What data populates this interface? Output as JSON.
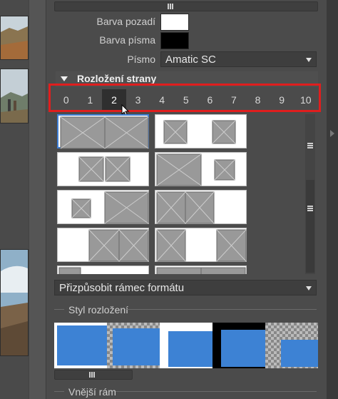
{
  "props": {
    "barva_pozadi_label": "Barva pozadí",
    "barva_pisma_label": "Barva písma",
    "pismo_label": "Písmo",
    "pismo_value": "Amatic SC",
    "bg_color": "#ffffff",
    "font_color": "#000000"
  },
  "layout_section": {
    "title": "Rozložení strany",
    "numbers": [
      "0",
      "1",
      "2",
      "3",
      "4",
      "5",
      "6",
      "7",
      "8",
      "9",
      "10"
    ],
    "selected_index": 2
  },
  "format_select": {
    "value": "Přizpůsobit rámec formátu"
  },
  "styl": {
    "label": "Styl rozložení"
  },
  "vnejsi": {
    "label": "Vnější rám"
  },
  "colors": {
    "accent_blue": "#3d82d4",
    "highlight_red": "#e01e1e"
  },
  "icons": {
    "section_toggle": "triangle-down-icon",
    "select_caret": "caret-down-icon",
    "cursor": "mouse-pointer-icon",
    "grip": "scroll-grip-icon",
    "panel_toggle": "chevron-right-icon"
  }
}
